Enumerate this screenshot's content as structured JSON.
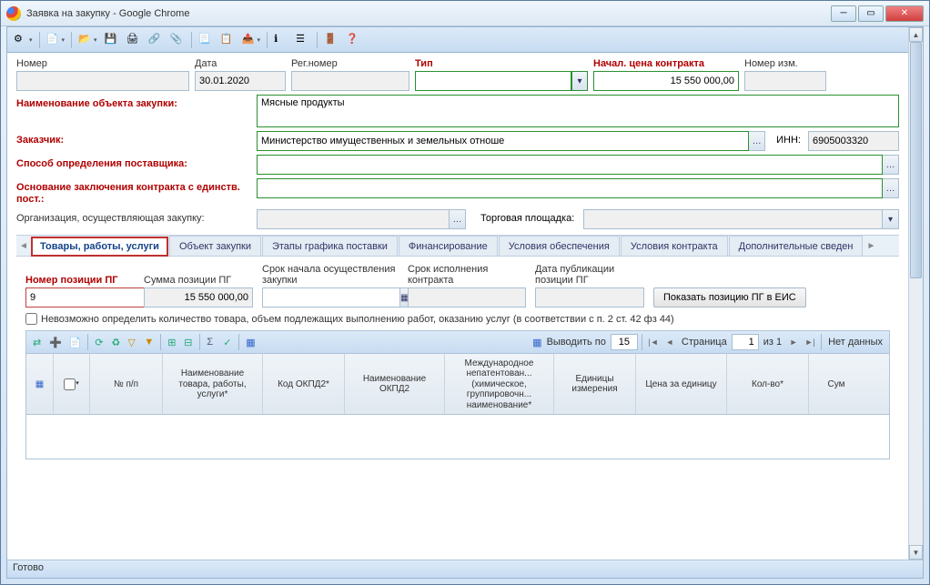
{
  "window": {
    "title": "Заявка на закупку - Google Chrome"
  },
  "header_fields": {
    "number": {
      "label": "Номер",
      "value": ""
    },
    "date": {
      "label": "Дата",
      "value": "30.01.2020"
    },
    "reg_no": {
      "label": "Рег.номер",
      "value": ""
    },
    "type": {
      "label": "Тип",
      "value": ""
    },
    "start_price": {
      "label": "Начал. цена контракта",
      "value": "15 550 000,00"
    },
    "change_no": {
      "label": "Номер изм.",
      "value": ""
    }
  },
  "main_fields": {
    "object_name": {
      "label": "Наименование объекта закупки:",
      "value": "Мясные продукты"
    },
    "customer": {
      "label": "Заказчик:",
      "value": "Министерство имущественных и земельных отноше"
    },
    "inn": {
      "label": "ИНН:",
      "value": "6905003320"
    },
    "supplier_method": {
      "label": "Способ определения поставщика:",
      "value": ""
    },
    "single_basis": {
      "label": "Основание заключения контракта с единств. пост.:",
      "value": ""
    },
    "org": {
      "label": "Организация, осуществляющая закупку:",
      "value": ""
    },
    "platform": {
      "label": "Торговая площадка:",
      "value": ""
    }
  },
  "tabs": [
    "Товары, работы, услуги",
    "Объект закупки",
    "Этапы графика поставки",
    "Финансирование",
    "Условия обеспечения",
    "Условия контракта",
    "Дополнительные сведен"
  ],
  "subform": {
    "pos_no": {
      "label": "Номер позиции ПГ",
      "value": "9"
    },
    "pos_sum": {
      "label": "Сумма позиции ПГ",
      "value": "15 550 000,00"
    },
    "start_date": {
      "label": "Срок начала осуществления закупки",
      "value": ""
    },
    "exec_date": {
      "label": "Срок исполнения контракта",
      "value": ""
    },
    "pub_date": {
      "label": "Дата публикации позиции ПГ",
      "value": ""
    },
    "show_btn": "Показать позицию ПГ в ЕИС",
    "checkbox": "Невозможно определить количество товара, объем подлежащих выполнению работ, оказанию услуг (в соответствии с п. 2 ст. 42 фз 44)"
  },
  "grid": {
    "pager": {
      "show_by": "Выводить по",
      "show_val": "15",
      "page_label": "Страница",
      "page_val": "1",
      "of": "из 1",
      "nodata": "Нет данных"
    },
    "columns": [
      "",
      "",
      "№ п/п",
      "Наименование товара, работы, услуги*",
      "Код ОКПД2*",
      "Наименование ОКПД2",
      "Международное непатентован... (химическое, группировочн... наименование*",
      "Единицы измерения",
      "Цена за единицу",
      "Кол-во*",
      "Сум"
    ]
  },
  "status": "Готово",
  "icons": {
    "ellipsis": "…",
    "cal": "📅"
  }
}
